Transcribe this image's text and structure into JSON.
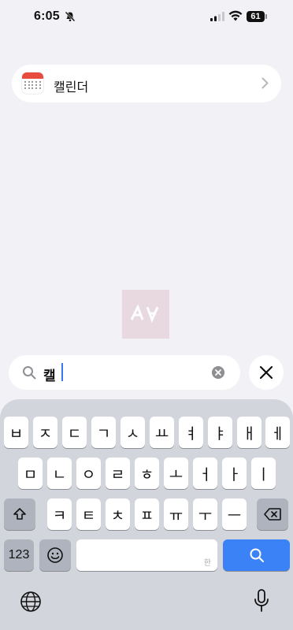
{
  "status_bar": {
    "time": "6:05",
    "battery": "61"
  },
  "results": [
    {
      "label": "캘린더",
      "icon": "calendar-icon"
    }
  ],
  "search": {
    "query": "캘"
  },
  "keyboard": {
    "row1": [
      "ㅂ",
      "ㅈ",
      "ㄷ",
      "ㄱ",
      "ㅅ",
      "ㅛ",
      "ㅕ",
      "ㅑ",
      "ㅐ",
      "ㅔ"
    ],
    "row2": [
      "ㅁ",
      "ㄴ",
      "ㅇ",
      "ㄹ",
      "ㅎ",
      "ㅗ",
      "ㅓ",
      "ㅏ",
      "ㅣ"
    ],
    "row3": [
      "ㅋ",
      "ㅌ",
      "ㅊ",
      "ㅍ",
      "ㅠ",
      "ㅜ",
      "ㅡ"
    ],
    "numbers_label": "123",
    "space_hint": "한",
    "shift_icon": "shift-icon",
    "delete_icon": "delete-icon",
    "emoji_icon": "emoji-icon",
    "search_icon": "search-icon",
    "globe_icon": "globe-icon",
    "mic_icon": "mic-icon"
  },
  "colors": {
    "accent": "#3a82f6",
    "background": "#f2f2f6",
    "keyboard": "#d3d5dc"
  }
}
